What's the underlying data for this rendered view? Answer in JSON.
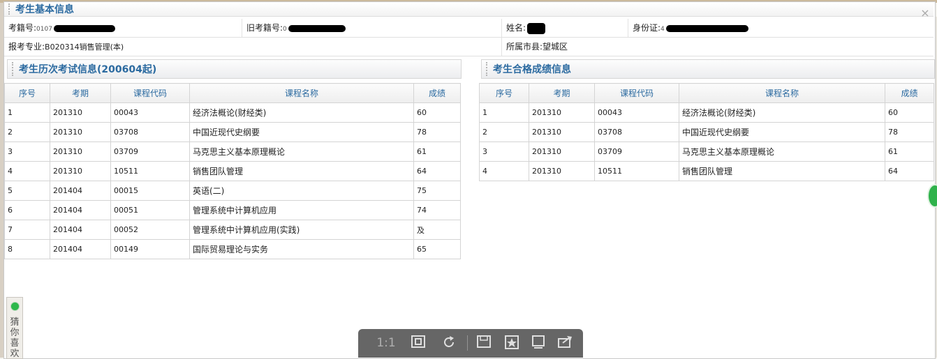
{
  "window": {
    "close_label": "×"
  },
  "basic_info": {
    "title": "考生基本信息",
    "exam_no_label": "考籍号:",
    "exam_no_visible": "0107",
    "old_exam_no_label": "旧考籍号:",
    "old_exam_no_visible": "0",
    "name_label": "姓名:",
    "id_label": "身份证:",
    "id_visible": "4",
    "major_label": "报考专业:",
    "major_value": "B020314销售管理(本)",
    "city_label": "所属市县:",
    "city_value": "望城区"
  },
  "history": {
    "title": "考生历次考试信息(200604起)",
    "columns": [
      "序号",
      "考期",
      "课程代码",
      "课程名称",
      "成绩"
    ],
    "rows": [
      [
        "1",
        "201310",
        "00043",
        "经济法概论(财经类)",
        "60"
      ],
      [
        "2",
        "201310",
        "03708",
        "中国近现代史纲要",
        "78"
      ],
      [
        "3",
        "201310",
        "03709",
        "马克思主义基本原理概论",
        "61"
      ],
      [
        "4",
        "201310",
        "10511",
        "销售团队管理",
        "64"
      ],
      [
        "5",
        "201404",
        "00015",
        "英语(二)",
        "75"
      ],
      [
        "6",
        "201404",
        "00051",
        "管理系统中计算机应用",
        "74"
      ],
      [
        "7",
        "201404",
        "00052",
        "管理系统中计算机应用(实践)",
        "及"
      ],
      [
        "8",
        "201404",
        "00149",
        "国际贸易理论与实务",
        "65"
      ]
    ]
  },
  "passed": {
    "title": "考生合格成绩信息",
    "columns": [
      "序号",
      "考期",
      "课程代码",
      "课程名称",
      "成绩"
    ],
    "rows": [
      [
        "1",
        "201310",
        "00043",
        "经济法概论(财经类)",
        "60"
      ],
      [
        "2",
        "201310",
        "03708",
        "中国近现代史纲要",
        "78"
      ],
      [
        "3",
        "201310",
        "03709",
        "马克思主义基本原理概论",
        "61"
      ],
      [
        "4",
        "201310",
        "10511",
        "销售团队管理",
        "64"
      ]
    ]
  },
  "side_tab": {
    "label": "猜你喜欢"
  },
  "toolbar": {
    "original_size_label": "1:1"
  }
}
